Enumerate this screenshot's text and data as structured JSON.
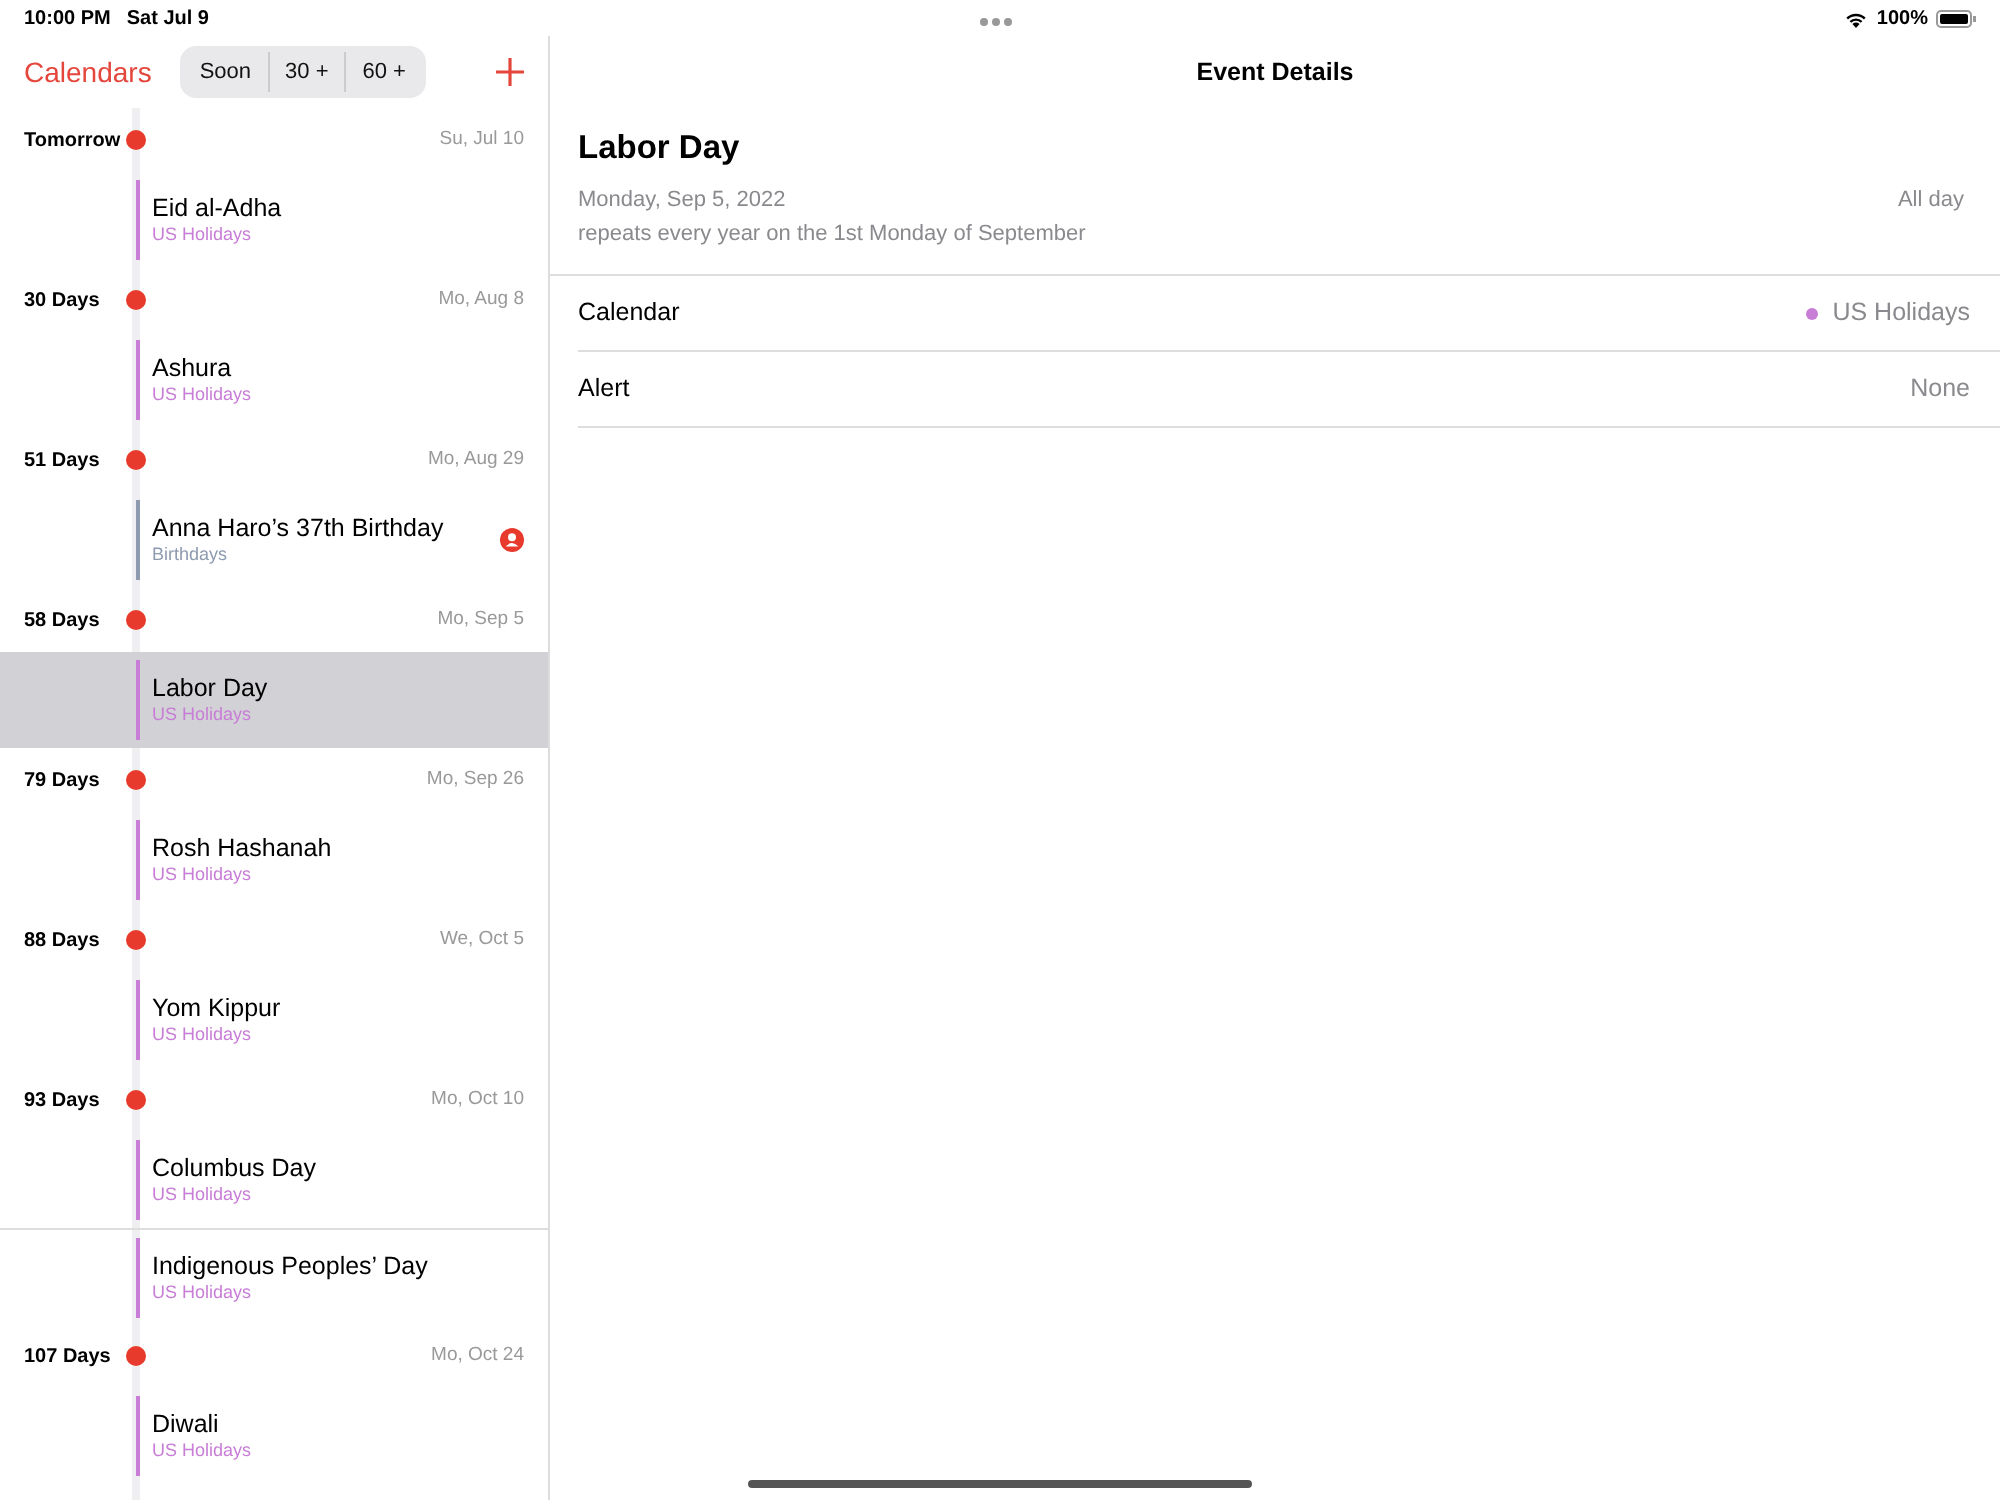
{
  "status_bar": {
    "time": "10:00 PM",
    "date": "Sat Jul 9",
    "battery": "100%"
  },
  "sidebar": {
    "back_label": "Calendars",
    "segments": [
      {
        "label": "Soon",
        "selected": false
      },
      {
        "label": "30 +",
        "selected": false
      },
      {
        "label": "60 +",
        "selected": false
      }
    ],
    "groups": [
      {
        "label": "Tomorrow",
        "date": "Su, Jul 10",
        "events": [
          {
            "title": "Eid al-Adha",
            "calendar": "US Holidays",
            "color": "#c87dd6",
            "selected": false,
            "contact": false
          }
        ]
      },
      {
        "label": "30 Days",
        "date": "Mo, Aug 8",
        "events": [
          {
            "title": "Ashura",
            "calendar": "US Holidays",
            "color": "#c87dd6",
            "selected": false,
            "contact": false
          }
        ]
      },
      {
        "label": "51 Days",
        "date": "Mo, Aug 29",
        "events": [
          {
            "title": "Anna Haro’s 37th Birthday",
            "calendar": "Birthdays",
            "color": "#8e9aaf",
            "selected": false,
            "contact": true
          }
        ]
      },
      {
        "label": "58 Days",
        "date": "Mo, Sep 5",
        "events": [
          {
            "title": "Labor Day",
            "calendar": "US Holidays",
            "color": "#c87dd6",
            "selected": true,
            "contact": false
          }
        ]
      },
      {
        "label": "79 Days",
        "date": "Mo, Sep 26",
        "events": [
          {
            "title": "Rosh Hashanah",
            "calendar": "US Holidays",
            "color": "#c87dd6",
            "selected": false,
            "contact": false
          }
        ]
      },
      {
        "label": "88 Days",
        "date": "We, Oct 5",
        "events": [
          {
            "title": "Yom Kippur",
            "calendar": "US Holidays",
            "color": "#c87dd6",
            "selected": false,
            "contact": false
          }
        ]
      },
      {
        "label": "93 Days",
        "date": "Mo, Oct 10",
        "events": [
          {
            "title": "Columbus Day",
            "calendar": "US Holidays",
            "color": "#c87dd6",
            "selected": false,
            "contact": false
          },
          {
            "title": "Indigenous Peoples’ Day",
            "calendar": "US Holidays",
            "color": "#c87dd6",
            "selected": false,
            "contact": false
          }
        ]
      },
      {
        "label": "107 Days",
        "date": "Mo, Oct 24",
        "events": [
          {
            "title": "Diwali",
            "calendar": "US Holidays",
            "color": "#c87dd6",
            "selected": false,
            "contact": false
          }
        ]
      }
    ]
  },
  "detail": {
    "nav_title": "Event Details",
    "title": "Labor Day",
    "date": "Monday, Sep 5, 2022",
    "all_day": "All day",
    "repeat": "repeats every year on the 1st Monday of September",
    "rows": [
      {
        "label": "Calendar",
        "value": "US Holidays",
        "color": "#c87dd6"
      },
      {
        "label": "Alert",
        "value": "None"
      }
    ]
  }
}
